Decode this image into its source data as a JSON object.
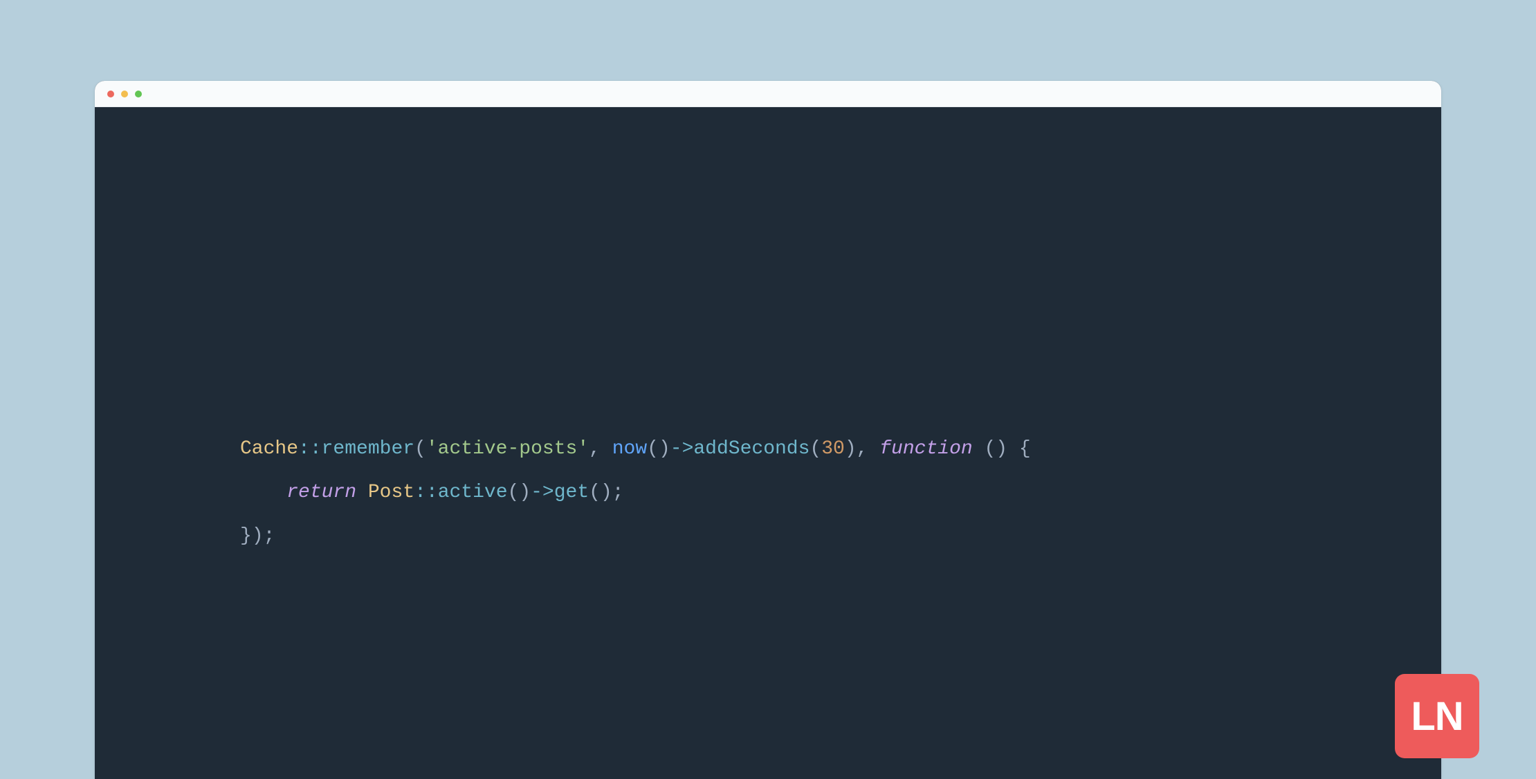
{
  "code": {
    "line1": {
      "class": "Cache",
      "scope": "::",
      "method": "remember",
      "open_paren": "(",
      "str_quote1": "'",
      "str_val": "active-posts",
      "str_quote2": "'",
      "comma1": ", ",
      "now": "now",
      "now_parens": "()",
      "arrow1": "->",
      "addSeconds": "addSeconds",
      "as_open": "(",
      "num": "30",
      "as_close": ")",
      "comma2": ", ",
      "function_kw": "function",
      "space": " ",
      "fn_parens": "()",
      "space2": " ",
      "brace_open": "{"
    },
    "line2": {
      "indent": "    ",
      "return_kw": "return",
      "space": " ",
      "class": "Post",
      "scope": "::",
      "active": "active",
      "active_parens": "()",
      "arrow": "->",
      "get": "get",
      "get_parens": "()",
      "semi": ";"
    },
    "line3": {
      "brace_close": "}",
      "close_paren": ")",
      "semi": ";"
    }
  },
  "badge": {
    "text": "LN"
  }
}
